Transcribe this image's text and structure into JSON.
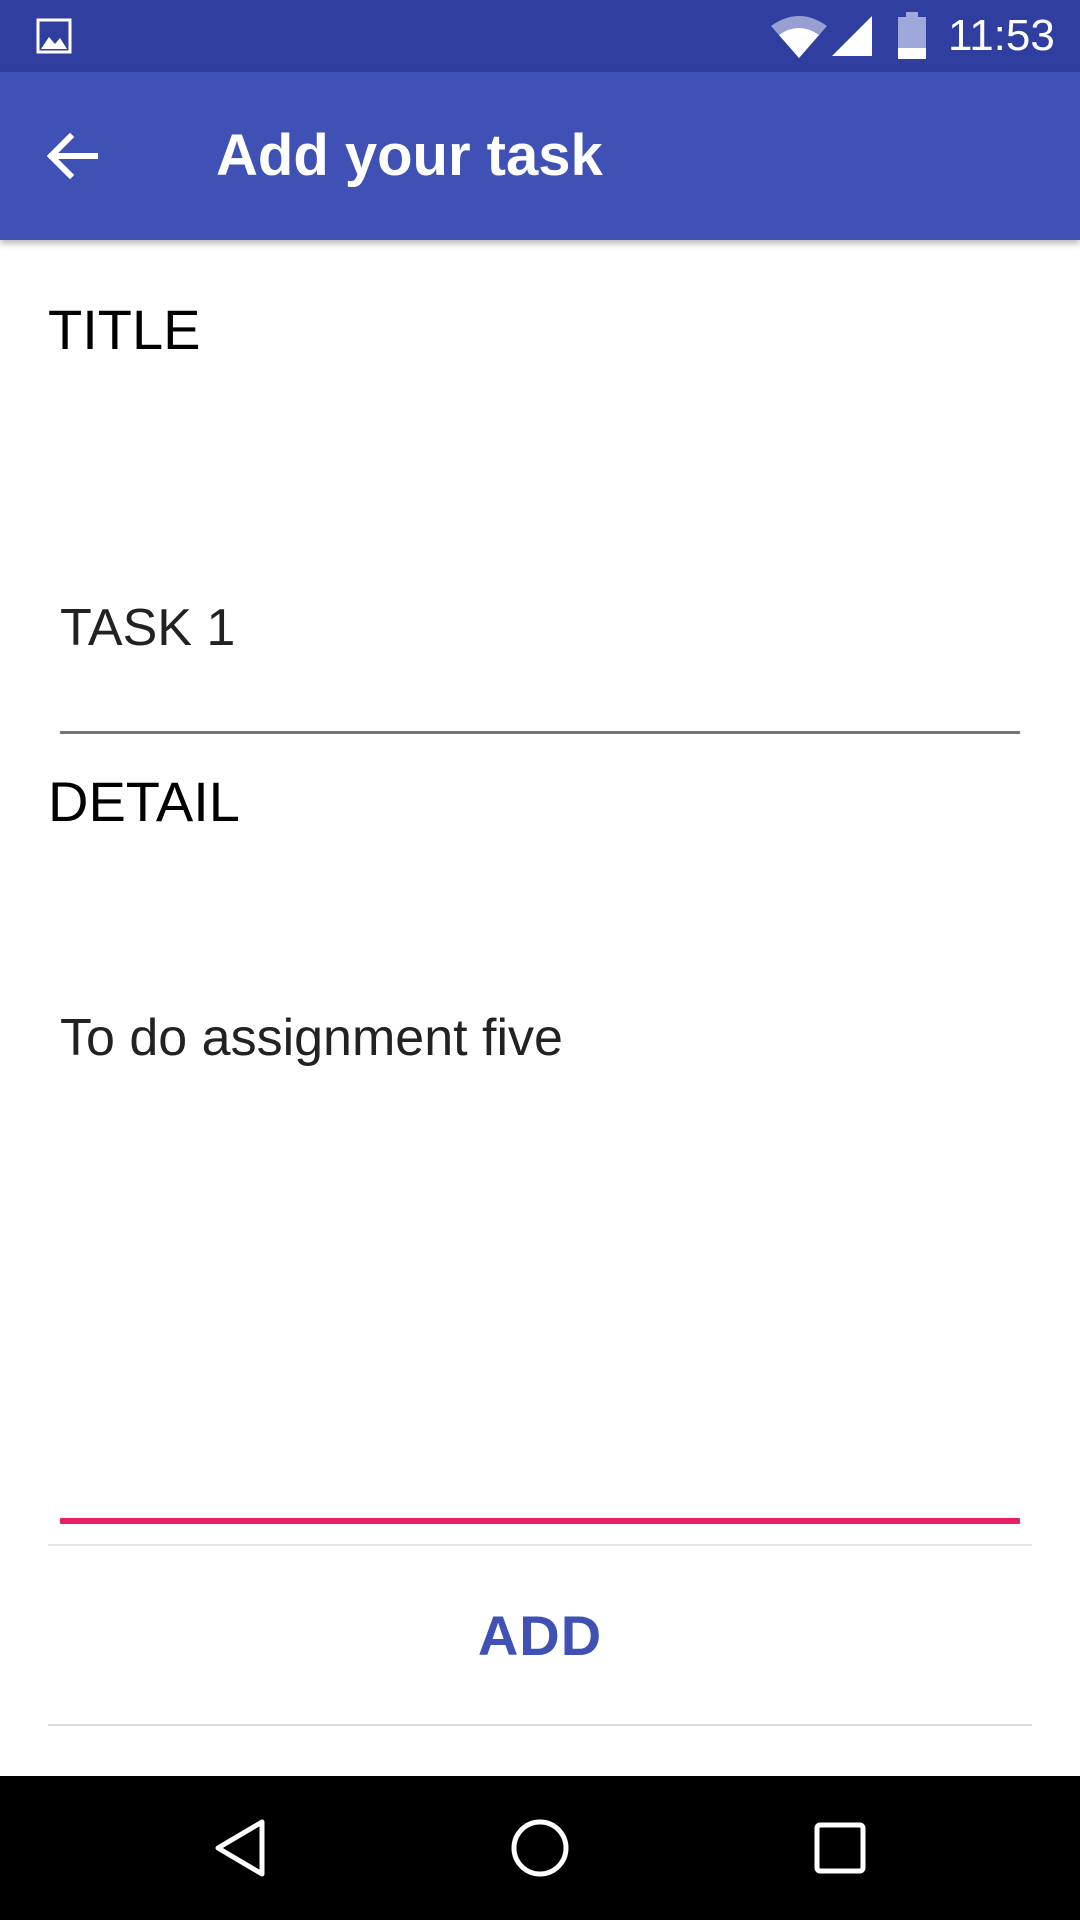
{
  "status_bar": {
    "time": "11:53",
    "icons": [
      "gallery-icon",
      "wifi-icon",
      "signal-icon",
      "battery-icon"
    ],
    "background": "#303f9f"
  },
  "app_bar": {
    "title": "Add your task",
    "back_icon": "arrow-back-icon",
    "background": "#3f51b5"
  },
  "form": {
    "title_label": "TITLE",
    "title_value": "TASK 1",
    "detail_label": "DETAIL",
    "detail_value": "To do assignment five",
    "focus_color": "#e91e63"
  },
  "actions": {
    "add_label": "ADD",
    "accent": "#3f51b5"
  },
  "nav_bar": {
    "icons": [
      "nav-back-icon",
      "nav-home-icon",
      "nav-recents-icon"
    ]
  }
}
